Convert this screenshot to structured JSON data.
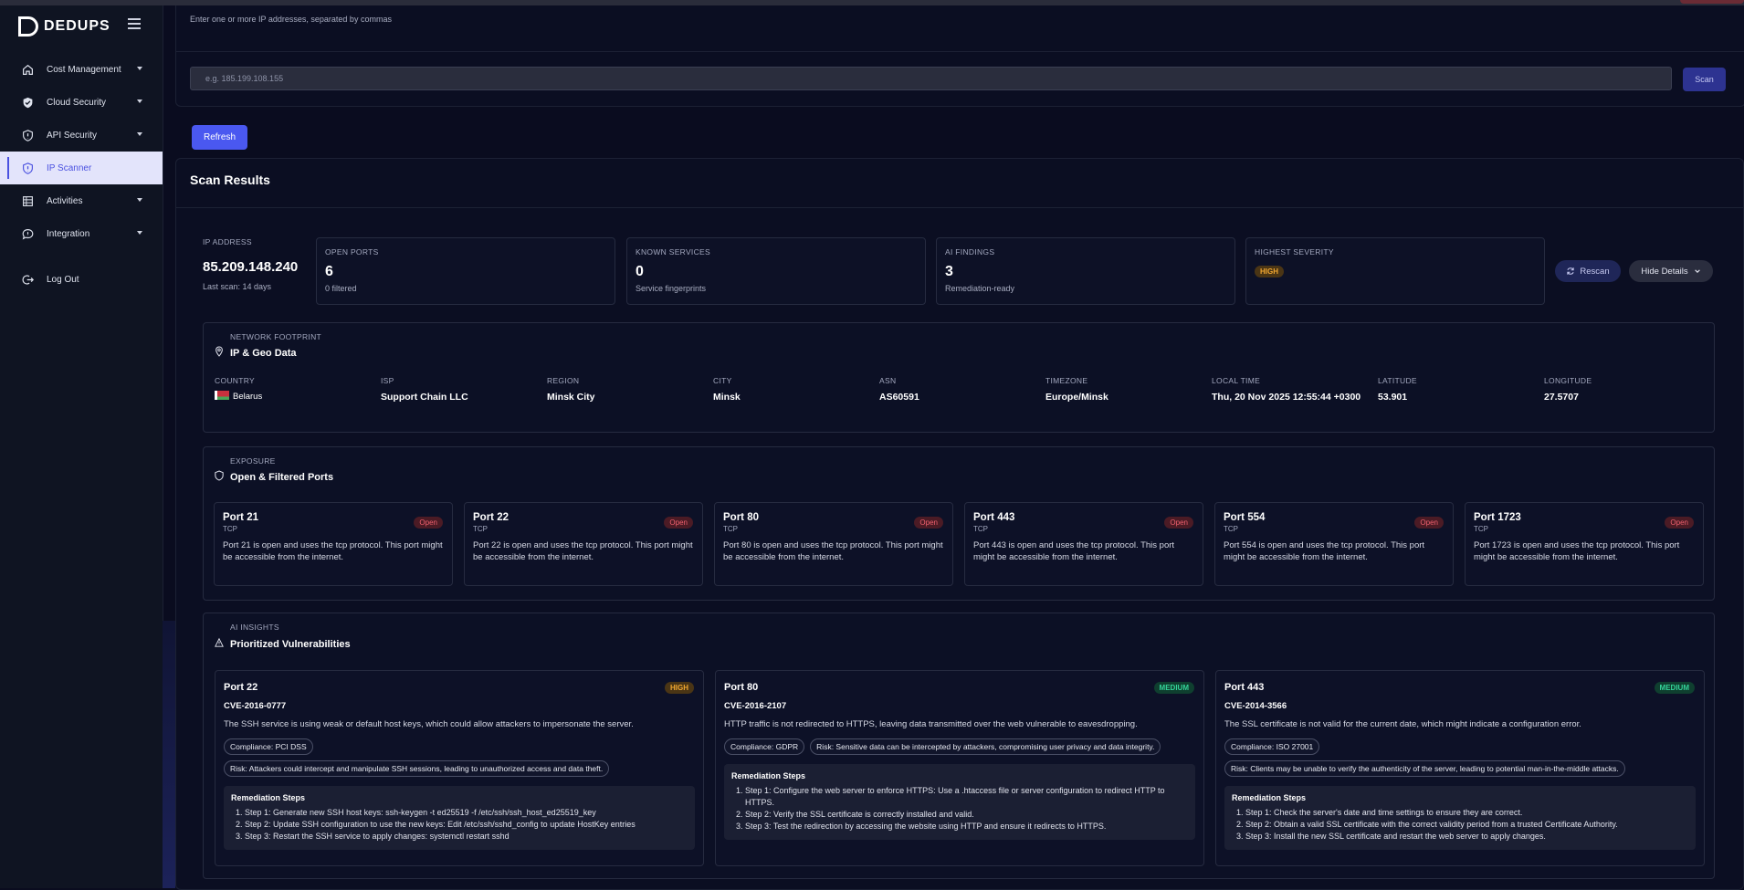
{
  "app": {
    "logo_text": "DEDUPS"
  },
  "sidebar": {
    "items": [
      {
        "label": "Cost Management",
        "icon": "home-icon"
      },
      {
        "label": "Cloud Security",
        "icon": "shield-check-icon"
      },
      {
        "label": "API Security",
        "icon": "shield-alert-icon"
      },
      {
        "label": "IP Scanner",
        "icon": "shield-alert-icon"
      },
      {
        "label": "Activities",
        "icon": "table-icon"
      },
      {
        "label": "Integration",
        "icon": "chat-icon"
      }
    ],
    "logout_label": "Log Out"
  },
  "scan_form": {
    "hint": "Enter one or more IP addresses, separated by commas",
    "placeholder": "e.g. 185.199.108.155",
    "scan_label": "Scan",
    "refresh_label": "Refresh"
  },
  "results": {
    "title": "Scan Results",
    "ip_label": "IP ADDRESS",
    "ip": "85.209.148.240",
    "last_scan": "Last scan: 14 days",
    "stats": [
      {
        "label": "OPEN PORTS",
        "value": "6",
        "sub": "0 filtered"
      },
      {
        "label": "KNOWN SERVICES",
        "value": "0",
        "sub": "Service fingerprints"
      },
      {
        "label": "AI FINDINGS",
        "value": "3",
        "sub": "Remediation-ready"
      }
    ],
    "severity_label": "HIGHEST SEVERITY",
    "severity_value": "HIGH",
    "rescan_label": "Rescan",
    "hide_label": "Hide Details"
  },
  "geo": {
    "kicker": "NETWORK FOOTPRINT",
    "title": "IP & Geo Data",
    "fields": [
      {
        "label": "COUNTRY",
        "value": "Belarus"
      },
      {
        "label": "ISP",
        "value": "Support Chain LLC"
      },
      {
        "label": "REGION",
        "value": "Minsk City"
      },
      {
        "label": "CITY",
        "value": "Minsk"
      },
      {
        "label": "ASN",
        "value": "AS60591"
      },
      {
        "label": "TIMEZONE",
        "value": "Europe/Minsk"
      },
      {
        "label": "LOCAL TIME",
        "value": "Thu, 20 Nov 2025 12:55:44 +0300"
      },
      {
        "label": "LATITUDE",
        "value": "53.901"
      },
      {
        "label": "LONGITUDE",
        "value": "27.5707"
      }
    ]
  },
  "ports": {
    "kicker": "EXPOSURE",
    "title": "Open & Filtered Ports",
    "items": [
      {
        "name": "Port 21",
        "proto": "TCP",
        "status": "Open",
        "desc": "Port 21 is open and uses the tcp protocol. This port might be accessible from the internet."
      },
      {
        "name": "Port 22",
        "proto": "TCP",
        "status": "Open",
        "desc": "Port 22 is open and uses the tcp protocol. This port might be accessible from the internet."
      },
      {
        "name": "Port 80",
        "proto": "TCP",
        "status": "Open",
        "desc": "Port 80 is open and uses the tcp protocol. This port might be accessible from the internet."
      },
      {
        "name": "Port 443",
        "proto": "TCP",
        "status": "Open",
        "desc": "Port 443 is open and uses the tcp protocol. This port might be accessible from the internet."
      },
      {
        "name": "Port 554",
        "proto": "TCP",
        "status": "Open",
        "desc": "Port 554 is open and uses the tcp protocol. This port might be accessible from the internet."
      },
      {
        "name": "Port 1723",
        "proto": "TCP",
        "status": "Open",
        "desc": "Port 1723 is open and uses the tcp protocol. This port might be accessible from the internet."
      }
    ]
  },
  "insights": {
    "kicker": "AI INSIGHTS",
    "title": "Prioritized Vulnerabilities",
    "remediation_title": "Remediation Steps",
    "items": [
      {
        "port": "Port 22",
        "severity": "HIGH",
        "cve": "CVE-2016-0777",
        "desc": "The SSH service is using weak or default host keys, which could allow attackers to impersonate the server.",
        "compliance": "Compliance: PCI DSS",
        "risk": "Risk: Attackers could intercept and manipulate SSH sessions, leading to unauthorized access and data theft.",
        "steps": [
          "Step 1: Generate new SSH host keys: ssh-keygen -t ed25519 -f /etc/ssh/ssh_host_ed25519_key",
          "Step 2: Update SSH configuration to use the new keys: Edit /etc/ssh/sshd_config to update HostKey entries",
          "Step 3: Restart the SSH service to apply changes: systemctl restart sshd"
        ]
      },
      {
        "port": "Port 80",
        "severity": "MEDIUM",
        "cve": "CVE-2016-2107",
        "desc": "HTTP traffic is not redirected to HTTPS, leaving data transmitted over the web vulnerable to eavesdropping.",
        "compliance": "Compliance: GDPR",
        "risk": "Risk: Sensitive data can be intercepted by attackers, compromising user privacy and data integrity.",
        "steps": [
          "Step 1: Configure the web server to enforce HTTPS: Use a .htaccess file or server configuration to redirect HTTP to HTTPS.",
          "Step 2: Verify the SSL certificate is correctly installed and valid.",
          "Step 3: Test the redirection by accessing the website using HTTP and ensure it redirects to HTTPS."
        ]
      },
      {
        "port": "Port 443",
        "severity": "MEDIUM",
        "cve": "CVE-2014-3566",
        "desc": "The SSL certificate is not valid for the current date, which might indicate a configuration error.",
        "compliance": "Compliance: ISO 27001",
        "risk": "Risk: Clients may be unable to verify the authenticity of the server, leading to potential man-in-the-middle attacks.",
        "steps": [
          "Step 1: Check the server's date and time settings to ensure they are correct.",
          "Step 2: Obtain a valid SSL certificate with the correct validity period from a trusted Certificate Authority.",
          "Step 3: Install the new SSL certificate and restart the web server to apply changes."
        ]
      }
    ]
  }
}
